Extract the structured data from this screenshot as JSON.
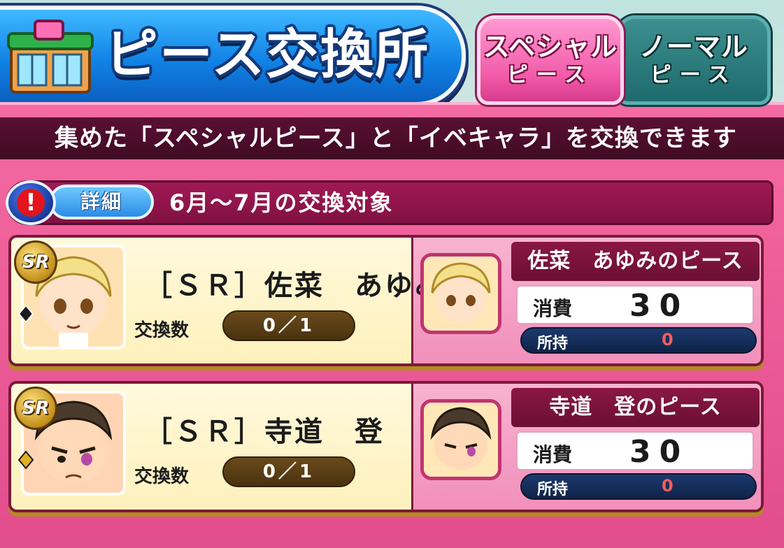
{
  "header": {
    "title": "ピース交換所"
  },
  "tabs": [
    {
      "line1": "スペシャル",
      "line2": "ピース",
      "active": true
    },
    {
      "line1": "ノーマル",
      "line2": "ピース",
      "active": false
    }
  ],
  "info": {
    "text": "集めた「スペシャルピース」と「イベキャラ」を交換できます"
  },
  "period": {
    "detail_label": "詳細",
    "title": "6月〜7月の交換対象"
  },
  "cards": [
    {
      "rank": "SR",
      "name": "［ＳＲ］佐菜　あゆみ",
      "count_label": "交換数",
      "count": "0／1",
      "piece_name": "佐菜　あゆみのピース",
      "cost_label": "消費",
      "cost": "30",
      "owned_label": "所持",
      "owned": "0",
      "hair_color": "#f4e08a"
    },
    {
      "rank": "SR",
      "name": "［ＳＲ］寺道　登",
      "count_label": "交換数",
      "count": "0／1",
      "piece_name": "寺道　登のピース",
      "cost_label": "消費",
      "cost": "30",
      "owned_label": "所持",
      "owned": "0",
      "hair_color": "#4a3a2c"
    }
  ],
  "colors": {
    "accent_pink": "#f25aa8",
    "banner_blue": "#1183e6",
    "dark_teal": "#1e6b6d"
  }
}
